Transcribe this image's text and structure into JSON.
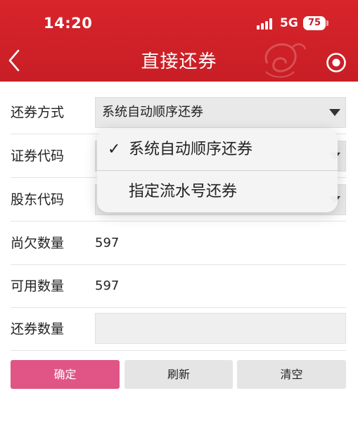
{
  "status_bar": {
    "time": "14:20",
    "network": "5G",
    "battery": "75"
  },
  "nav": {
    "title": "直接还券",
    "back_icon": "chevron-left-icon",
    "right_icon": "record-icon"
  },
  "form": {
    "repay_method": {
      "label": "还券方式",
      "value": "系统自动顺序还券"
    },
    "security_code": {
      "label": "证券代码",
      "value": ""
    },
    "shareholder_code": {
      "label": "股东代码",
      "value": ""
    },
    "owed_quantity": {
      "label": "尚欠数量",
      "value": "597"
    },
    "available_quantity": {
      "label": "可用数量",
      "value": "597"
    },
    "repay_quantity": {
      "label": "还券数量",
      "value": "",
      "placeholder": ""
    }
  },
  "buttons": {
    "confirm": "确定",
    "refresh": "刷新",
    "clear": "清空"
  },
  "dropdown": {
    "options": [
      {
        "label": "系统自动顺序还券",
        "selected": true,
        "check": "✓"
      },
      {
        "label": "指定流水号还券",
        "selected": false,
        "check": ""
      }
    ]
  },
  "colors": {
    "header": "#c81e25",
    "confirm_button": "#e05585",
    "secondary_button": "#e5e5e5"
  }
}
